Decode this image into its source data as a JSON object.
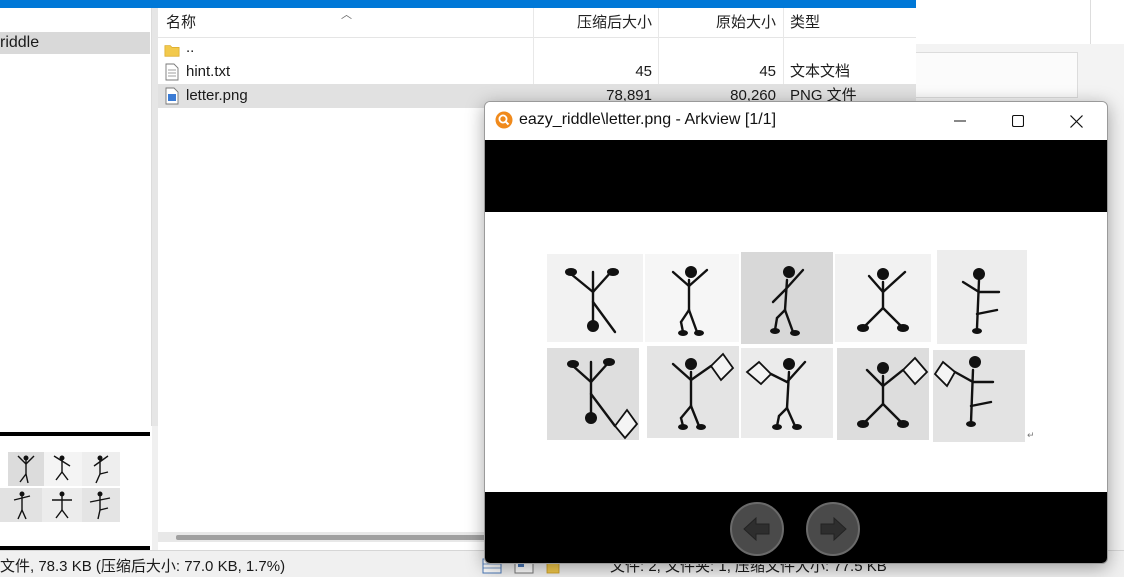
{
  "tree": {
    "selected_item": "riddle"
  },
  "file_list": {
    "columns": [
      "名称",
      "压缩后大小",
      "原始大小",
      "类型"
    ],
    "rows": [
      {
        "name": "..",
        "compressed": "",
        "original": "",
        "type": "",
        "icon": "folder-icon"
      },
      {
        "name": "hint.txt",
        "compressed": "45",
        "original": "45",
        "type": "文本文档",
        "icon": "text-file-icon"
      },
      {
        "name": "letter.png",
        "compressed": "78,891",
        "original": "80,260",
        "type": "PNG 文件",
        "icon": "image-file-icon",
        "selected": true
      }
    ]
  },
  "status": {
    "left": "文件, 78.3 KB (压缩后大小: 77.0 KB, 1.7%)",
    "right": "文件: 2, 文件夹: 1, 压缩文件大小: 77.5 KB"
  },
  "arkview": {
    "title": "eazy_riddle\\letter.png - Arkview [1/1]",
    "minimize_icon": "minimize-icon",
    "maximize_icon": "maximize-icon",
    "close_icon": "close-icon",
    "prev_icon": "arrow-left-icon",
    "next_icon": "arrow-right-icon"
  },
  "colors": {
    "accent": "#0078d7",
    "selection": "#e1e1e1",
    "logo": "#f08a1c"
  }
}
